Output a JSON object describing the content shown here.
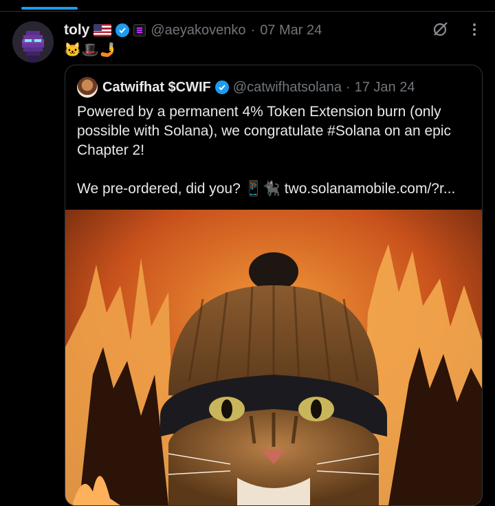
{
  "tabs": {
    "active_indicator_color": "#1d9bf0"
  },
  "post": {
    "author_name": "toly",
    "flag_icon": "us-flag-icon",
    "verified_icon": "verified-badge-icon",
    "affiliate_icon": "solana-affiliate-icon",
    "handle": "@aeyakovenko",
    "separator": "·",
    "date": "07 Mar 24",
    "emoji_text": "🐱🎩🤳"
  },
  "quote": {
    "author_name": "Catwifhat $CWIF",
    "verified_icon": "verified-badge-icon",
    "handle": "@catwifhatsolana",
    "separator": "·",
    "date": "17 Jan 24",
    "text_line1": "Powered by a permanent 4% Token Extension burn (only possible with Solana), we congratulate #Solana on an epic Chapter 2!",
    "text_line2": "We pre-ordered, did you? 📱🐈‍⬛ two.solanamobile.com/?r...",
    "image_alt": "cat wearing beanie in front of burning forest"
  },
  "colors": {
    "background": "#000000",
    "text": "#e7e9ea",
    "secondary": "#71767b",
    "accent": "#1d9bf0",
    "border": "#2f3336"
  }
}
